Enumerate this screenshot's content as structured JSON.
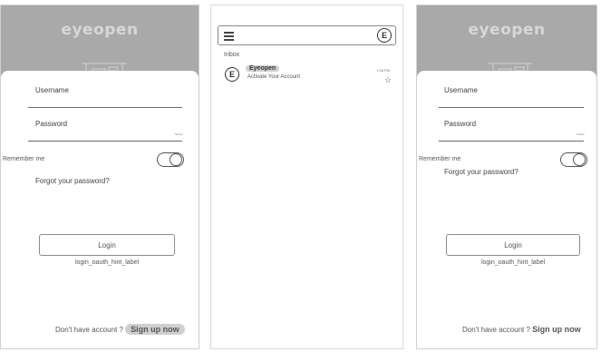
{
  "brand": {
    "logo_text": "eyeopen"
  },
  "login": {
    "username_label": "Username",
    "password_label": "Password",
    "eye_icon_glyph": "⌣⌣",
    "remember_label": "Remember me",
    "remember_toggle": "on",
    "forgot_label": "Forgot your password?",
    "login_button": "Login",
    "hint_label": "login_oauth_hint_label",
    "signup_prompt": "Don't have account ?",
    "signup_link": "Sign up now"
  },
  "inbox": {
    "avatar_letter": "E",
    "title": "Inbox",
    "messages": [
      {
        "avatar_letter": "E",
        "sender": "Eyeopen",
        "subject": "Activate Your Account",
        "time": "1:38 PM",
        "star_glyph": "☆"
      }
    ]
  },
  "colors": {
    "header_bg": "#a9a9a9",
    "logo_color": "#d7d7d7",
    "highlight": "#cfcfcf"
  }
}
